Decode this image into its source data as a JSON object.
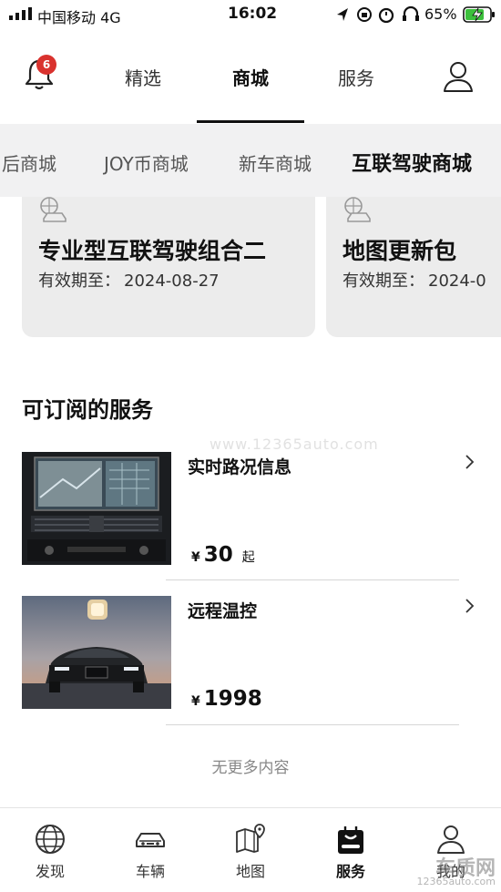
{
  "status_bar": {
    "carrier": "中国移动 4G",
    "time": "16:02",
    "battery_percent": "65%"
  },
  "header": {
    "notification_count": "6",
    "tabs": [
      {
        "label": "精选",
        "active": false
      },
      {
        "label": "商城",
        "active": true
      },
      {
        "label": "服务",
        "active": false
      }
    ],
    "icons": {
      "bell": "bell-icon",
      "profile": "user-profile-icon"
    }
  },
  "subcategories": [
    {
      "label": "后商城",
      "active": false
    },
    {
      "label": "JOY币商城",
      "active": false
    },
    {
      "label": "新车商城",
      "active": false
    },
    {
      "label": "互联驾驶商城",
      "active": true
    }
  ],
  "subscribed_cards": [
    {
      "title": "专业型互联驾驶组合二",
      "validity_label": "有效期至：",
      "validity_date": "2024-08-27",
      "icon": "connected-car-icon"
    },
    {
      "title": "地图更新包",
      "validity_label": "有效期至：",
      "validity_date": "2024-0",
      "icon": "connected-car-icon"
    }
  ],
  "services_section": {
    "title": "可订阅的服务",
    "items": [
      {
        "name": "实时路况信息",
        "currency": "¥",
        "price": "30",
        "suffix": "起",
        "image": "car-navigation-screen"
      },
      {
        "name": "远程温控",
        "currency": "¥",
        "price": "1998",
        "suffix": "",
        "image": "dark-bmw-sedan"
      }
    ],
    "end_text": "无更多内容"
  },
  "watermark": "www.12365auto.com",
  "bottom_nav": [
    {
      "label": "发现",
      "icon": "globe-icon",
      "active": false
    },
    {
      "label": "车辆",
      "icon": "car-icon",
      "active": false
    },
    {
      "label": "地图",
      "icon": "map-pin-icon",
      "active": false
    },
    {
      "label": "服务",
      "icon": "service-bag-icon",
      "active": true
    },
    {
      "label": "我的",
      "icon": "user-icon",
      "active": false
    }
  ],
  "corner_logo": {
    "text": "车质网",
    "url": "12365auto.com"
  },
  "colors": {
    "badge": "#d9322e",
    "card_bg": "#ececec",
    "subcat_bg": "#f1f1f2",
    "text": "#111111"
  }
}
